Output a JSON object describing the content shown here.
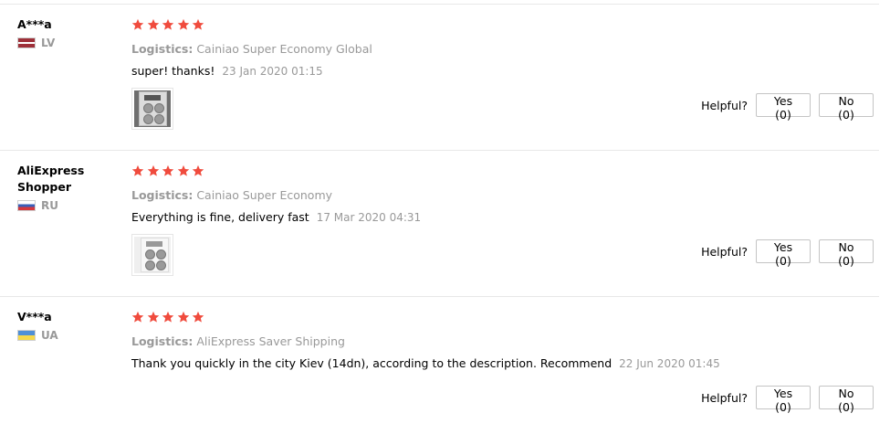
{
  "helpful_label": "Helpful?",
  "star_color": "#f04b3d",
  "reviews": [
    {
      "username": "A***a",
      "country": "LV",
      "flag": "latvia-flag",
      "rating": 5,
      "logistics_label": "Logistics:",
      "logistics_value": "Cainiao Super Economy Global",
      "text": "super! thanks!",
      "date": "23 Jan 2020 01:15",
      "has_photo": true,
      "yes_label": "Yes (0)",
      "no_label": "No (0)"
    },
    {
      "username": "AliExpress Shopper",
      "country": "RU",
      "flag": "russia-flag",
      "rating": 5,
      "logistics_label": "Logistics:",
      "logistics_value": "Cainiao Super Economy",
      "text": "Everything is fine, delivery fast",
      "date": "17 Mar 2020 04:31",
      "has_photo": true,
      "yes_label": "Yes (0)",
      "no_label": "No (0)"
    },
    {
      "username": "V***a",
      "country": "UA",
      "flag": "ukraine-flag",
      "rating": 5,
      "logistics_label": "Logistics:",
      "logistics_value": "AliExpress Saver Shipping",
      "text": "Thank you quickly in the city Kiev (14dn), according to the description. Recommend",
      "date": "22 Jun 2020 01:45",
      "has_photo": false,
      "yes_label": "Yes (0)",
      "no_label": "No (0)"
    }
  ]
}
